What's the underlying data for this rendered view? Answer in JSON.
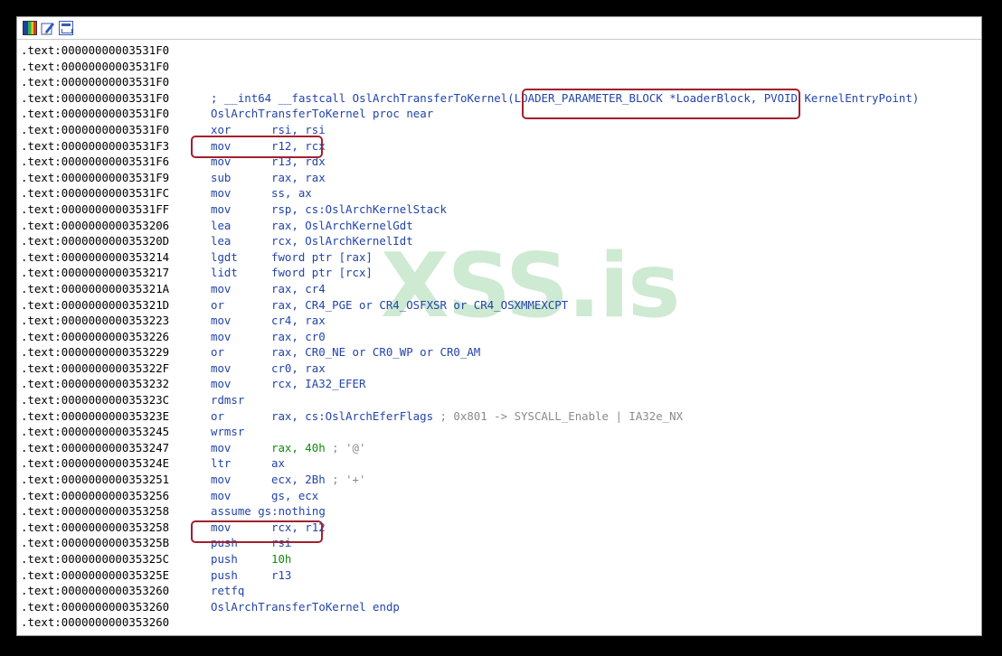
{
  "toolbar": {
    "icons": [
      "graph-overview-icon",
      "edit-icon",
      "layout-icon"
    ]
  },
  "watermark": "XSS.is",
  "lines": [
    {
      "addr": ".text:00000000003531F0",
      "mn": "",
      "op": "",
      "cm": ""
    },
    {
      "addr": ".text:00000000003531F0",
      "mn": "",
      "op": "",
      "cm": ""
    },
    {
      "addr": ".text:00000000003531F0",
      "mn": "",
      "op": "",
      "cm": ""
    },
    {
      "addr": ".text:00000000003531F0",
      "mn": "",
      "op": "",
      "cm": "",
      "header": "; __int64 __fastcall OslArchTransferToKernel(LOADER_PARAMETER_BLOCK *LoaderBlock, PVOID KernelEntryPoint)"
    },
    {
      "addr": ".text:00000000003531F0",
      "mn": "",
      "op": "",
      "cm": "",
      "header": "OslArchTransferToKernel proc near"
    },
    {
      "addr": ".text:00000000003531F0",
      "mn": "xor",
      "op": "rsi, rsi",
      "cm": ""
    },
    {
      "addr": ".text:00000000003531F3",
      "mn": "mov",
      "op": "r12, rcx",
      "cm": ""
    },
    {
      "addr": ".text:00000000003531F6",
      "mn": "mov",
      "op": "r13, rdx",
      "cm": ""
    },
    {
      "addr": ".text:00000000003531F9",
      "mn": "sub",
      "op": "rax, rax",
      "cm": ""
    },
    {
      "addr": ".text:00000000003531FC",
      "mn": "mov",
      "op": "ss, ax",
      "cm": ""
    },
    {
      "addr": ".text:00000000003531FF",
      "mn": "mov",
      "op": "rsp, cs:OslArchKernelStack",
      "cm": ""
    },
    {
      "addr": ".text:0000000000353206",
      "mn": "lea",
      "op": "rax, OslArchKernelGdt",
      "cm": ""
    },
    {
      "addr": ".text:000000000035320D",
      "mn": "lea",
      "op": "rcx, OslArchKernelIdt",
      "cm": ""
    },
    {
      "addr": ".text:0000000000353214",
      "mn": "lgdt",
      "op": "fword ptr [rax]",
      "cm": ""
    },
    {
      "addr": ".text:0000000000353217",
      "mn": "lidt",
      "op": "fword ptr [rcx]",
      "cm": ""
    },
    {
      "addr": ".text:000000000035321A",
      "mn": "mov",
      "op": "rax, cr4",
      "cm": ""
    },
    {
      "addr": ".text:000000000035321D",
      "mn": "or",
      "op": "rax, CR4_PGE or CR4_OSFXSR or CR4_OSXMMEXCPT",
      "cm": ""
    },
    {
      "addr": ".text:0000000000353223",
      "mn": "mov",
      "op": "cr4, rax",
      "cm": ""
    },
    {
      "addr": ".text:0000000000353226",
      "mn": "mov",
      "op": "rax, cr0",
      "cm": ""
    },
    {
      "addr": ".text:0000000000353229",
      "mn": "or",
      "op": "rax, CR0_NE or CR0_WP or CR0_AM",
      "cm": ""
    },
    {
      "addr": ".text:000000000035322F",
      "mn": "mov",
      "op": "cr0, rax",
      "cm": ""
    },
    {
      "addr": ".text:0000000000353232",
      "mn": "mov",
      "op": "rcx, IA32_EFER",
      "cm": ""
    },
    {
      "addr": ".text:000000000035323C",
      "mn": "rdmsr",
      "op": "",
      "cm": ""
    },
    {
      "addr": ".text:000000000035323E",
      "mn": "or",
      "op": "rax, cs:OslArchEferFlags",
      "cm": " ; 0x801 -> SYSCALL_Enable | IA32e_NX"
    },
    {
      "addr": ".text:0000000000353245",
      "mn": "wrmsr",
      "op": "",
      "cm": ""
    },
    {
      "addr": ".text:0000000000353247",
      "mn": "mov",
      "op": "rax, 40h",
      "cm": " ; '@'"
    },
    {
      "addr": ".text:000000000035324E",
      "mn": "ltr",
      "op": "ax",
      "cm": ""
    },
    {
      "addr": ".text:0000000000353251",
      "mn": "mov",
      "op": "ecx, 2Bh",
      "cm": " ; '+'"
    },
    {
      "addr": ".text:0000000000353256",
      "mn": "mov",
      "op": "gs, ecx",
      "cm": ""
    },
    {
      "addr": ".text:0000000000353258",
      "mn": "",
      "op": "",
      "cm": "",
      "header": "assume gs:nothing"
    },
    {
      "addr": ".text:0000000000353258",
      "mn": "mov",
      "op": "rcx, r12",
      "cm": ""
    },
    {
      "addr": ".text:000000000035325B",
      "mn": "push",
      "op": "rsi",
      "cm": ""
    },
    {
      "addr": ".text:000000000035325C",
      "mn": "push",
      "op": "10h",
      "cm": ""
    },
    {
      "addr": ".text:000000000035325E",
      "mn": "push",
      "op": "r13",
      "cm": ""
    },
    {
      "addr": ".text:0000000000353260",
      "mn": "retfq",
      "op": "",
      "cm": ""
    },
    {
      "addr": ".text:0000000000353260",
      "mn": "",
      "op": "",
      "cm": "",
      "header": "OslArchTransferToKernel endp"
    },
    {
      "addr": ".text:0000000000353260",
      "mn": "",
      "op": "",
      "cm": ""
    }
  ],
  "colors": {
    "highlight_box": "#a3202d",
    "mnemonic": "#2244aa",
    "number": "#108a10",
    "comment": "#8a8a8a"
  }
}
